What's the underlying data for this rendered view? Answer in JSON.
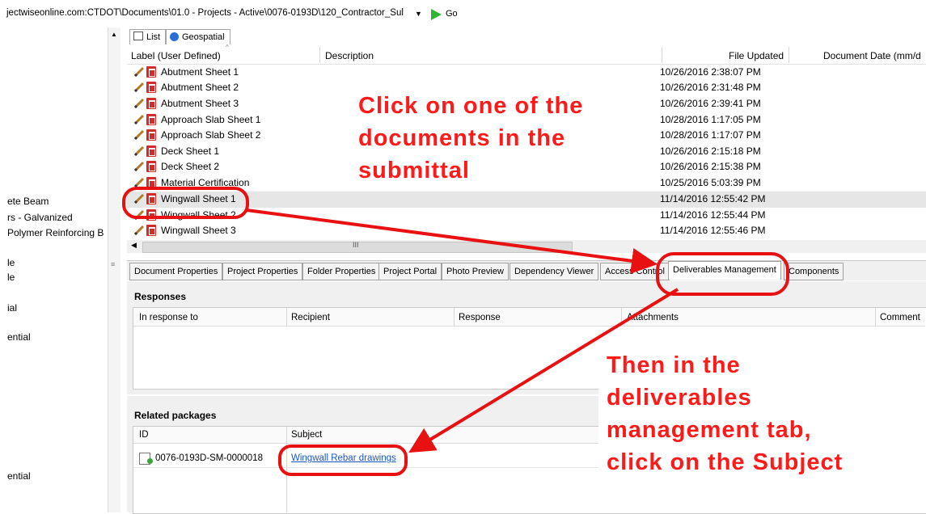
{
  "address_bar": {
    "path": "jectwiseonline.com:CTDOT\\Documents\\01.0 - Projects - Active\\0076-0193D\\120_Contractor_Sul",
    "go_label": "Go"
  },
  "left_tree": {
    "items": [
      "ete Beam",
      "rs - Galvanized",
      "Polymer Reinforcing B",
      "le",
      "le",
      "ial",
      "ential",
      "ential"
    ]
  },
  "view_tabs": [
    "List",
    "Geospatial"
  ],
  "list": {
    "columns": [
      "Label (User Defined)",
      "Description",
      "File Updated",
      "Document Date (mm/d"
    ],
    "rows": [
      {
        "label": "Abutment Sheet 1",
        "updated": "10/26/2016 2:38:07 PM"
      },
      {
        "label": "Abutment Sheet 2",
        "updated": "10/26/2016 2:31:48 PM"
      },
      {
        "label": "Abutment Sheet 3",
        "updated": "10/26/2016 2:39:41 PM"
      },
      {
        "label": "Approach Slab Sheet 1",
        "updated": "10/28/2016 1:17:05 PM"
      },
      {
        "label": "Approach Slab Sheet 2",
        "updated": "10/28/2016 1:17:07 PM"
      },
      {
        "label": "Deck Sheet 1",
        "updated": "10/26/2016 2:15:18 PM"
      },
      {
        "label": "Deck Sheet 2",
        "updated": "10/26/2016 2:15:38 PM"
      },
      {
        "label": "Material Certification",
        "updated": "10/25/2016 5:03:39 PM"
      },
      {
        "label": "Wingwall Sheet 1",
        "updated": "11/14/2016 12:55:42 PM"
      },
      {
        "label": "Wingwall Sheet 2",
        "updated": "11/14/2016 12:55:44 PM"
      },
      {
        "label": "Wingwall Sheet 3",
        "updated": "11/14/2016 12:55:46 PM"
      }
    ]
  },
  "detail_tabs": [
    "Document Properties",
    "Project Properties",
    "Folder Properties",
    "Project Portal",
    "Photo Preview",
    "Dependency Viewer",
    "Access Control",
    "Deliverables Management",
    "Components"
  ],
  "responses": {
    "title": "Responses",
    "columns": [
      "In response to",
      "Recipient",
      "Response",
      "Attachments",
      "Comment"
    ]
  },
  "related": {
    "title": "Related packages",
    "columns": [
      "ID",
      "Subject"
    ],
    "row": {
      "id": "0076-0193D-SM-0000018",
      "subject": "Wingwall Rebar drawings"
    }
  },
  "annotations": {
    "first": [
      "Click on one of the",
      "documents in the",
      "submittal"
    ],
    "second": [
      "Then in the",
      "deliverables",
      "management tab,",
      "click on the Subject"
    ]
  },
  "colors": {
    "annotation": "#ff1a1a",
    "go": "#2fb52f",
    "link": "#1a56c8"
  }
}
